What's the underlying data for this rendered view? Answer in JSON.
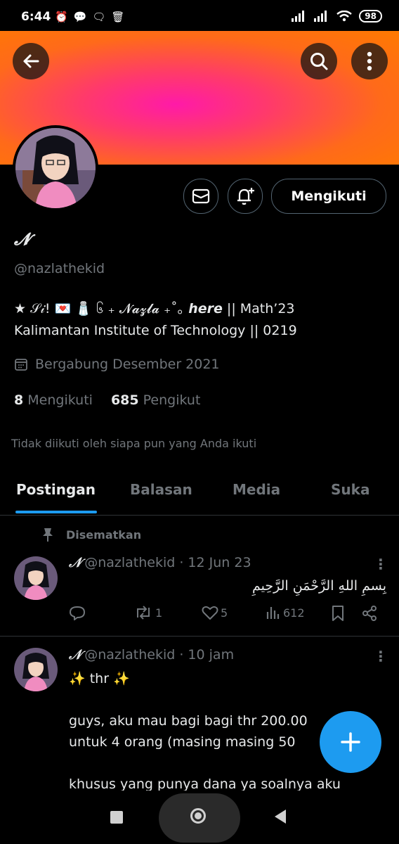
{
  "status_bar": {
    "time": "6:44",
    "battery": "98"
  },
  "profile": {
    "display_name": "𝓝",
    "handle": "@nazlathekid",
    "bio_line1_start": "★ 𝒮𝒾! 💌 🧂 ၆ ₊ 𝓝𝓪𝔃𝓵𝓪 ₊˚｡ ",
    "bio_line1_bold": "here",
    "bio_line1_end": " || Math’23",
    "bio_line2": "Kalimantan Institute of Technology || 0219",
    "joined": "Bergabung Desember 2021",
    "following_count": "8",
    "following_label": "Mengikuti",
    "followers_count": "685",
    "followers_label": "Pengikut",
    "followers_note": "Tidak diikuti oleh siapa pun yang Anda ikuti",
    "follow_button": "Mengikuti"
  },
  "tabs": [
    "Postingan",
    "Balasan",
    "Media",
    "Suka"
  ],
  "pinned_label": "Disematkan",
  "posts": [
    {
      "name": "𝒩",
      "handle_date": "@nazlathekid · 12 Jun 23",
      "text": "بِسمِ اللهِ الرَّحْمَنِ الرَّحِيمِ",
      "reposts": "1",
      "likes": "5",
      "views": "612"
    },
    {
      "name": "𝒩",
      "handle_date": "@nazlathekid · 10 jam",
      "line1": "✨ thr ✨",
      "line2": "guys, aku mau bagi bagi thr 200.00",
      "line3": "untuk 4 orang (masing masing 50",
      "line4": "khusus yang punya dana ya soalnya aku"
    }
  ],
  "icons": {
    "back": "back-arrow-icon",
    "search": "search-icon",
    "more": "more-vertical-icon",
    "message": "envelope-icon",
    "notify": "bell-plus-icon",
    "calendar": "calendar-icon",
    "pin": "pin-icon",
    "compose": "plus-icon"
  },
  "colors": {
    "accent": "#1d9bf0",
    "background": "#000000",
    "muted": "#71767b"
  }
}
